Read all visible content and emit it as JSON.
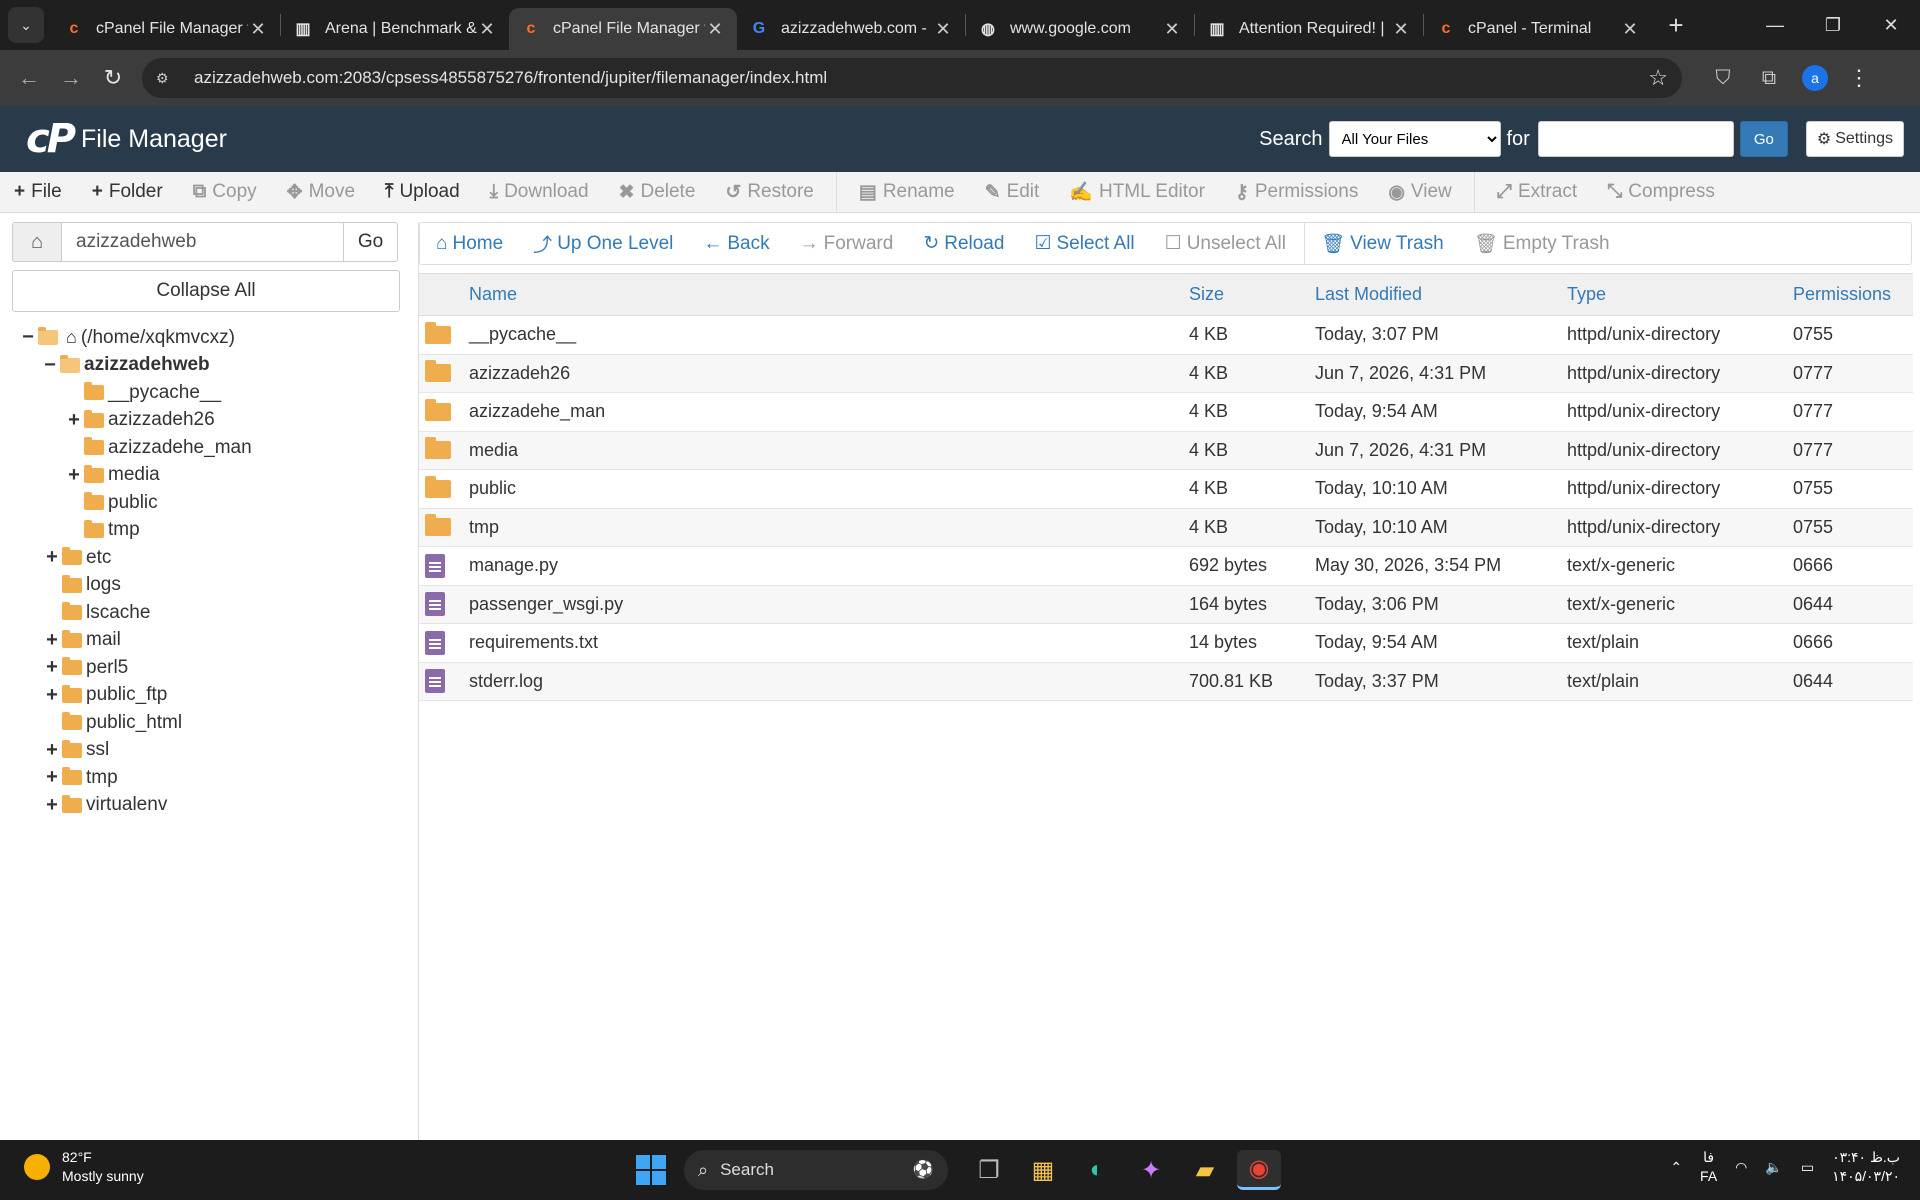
{
  "browser": {
    "tabs": [
      {
        "title": "cPanel File Manager v",
        "icon": "cpanel-icon",
        "active": false
      },
      {
        "title": "Arena | Benchmark &",
        "icon": "arena-icon",
        "active": false
      },
      {
        "title": "cPanel File Manager v",
        "icon": "cpanel-icon",
        "active": true
      },
      {
        "title": "azizzadehweb.com -",
        "icon": "google-icon",
        "active": false
      },
      {
        "title": "www.google.com",
        "icon": "globe-icon",
        "active": false
      },
      {
        "title": "Attention Required! |",
        "icon": "arena-icon",
        "active": false
      },
      {
        "title": "cPanel - Terminal",
        "icon": "cpanel-icon",
        "active": false
      }
    ],
    "url": "azizzadehweb.com:2083/cpsess4855875276/frontend/jupiter/filemanager/index.html",
    "profile_initial": "a"
  },
  "header": {
    "logo_mark": "cP",
    "title": "File Manager",
    "search_label": "Search",
    "search_scope": "All Your Files",
    "for_label": "for",
    "search_value": "",
    "go_label": "Go",
    "settings_label": "Settings"
  },
  "toolbar": {
    "file": "File",
    "folder": "Folder",
    "copy": "Copy",
    "move": "Move",
    "upload": "Upload",
    "download": "Download",
    "delete": "Delete",
    "restore": "Restore",
    "rename": "Rename",
    "edit": "Edit",
    "html_editor": "HTML Editor",
    "permissions": "Permissions",
    "view": "View",
    "extract": "Extract",
    "compress": "Compress"
  },
  "sidebar": {
    "path_value": "azizzadehweb",
    "go_label": "Go",
    "collapse_label": "Collapse All",
    "tree": {
      "root": "(/home/xqkmvcxz)",
      "current": "azizzadehweb",
      "c_pycache": "__pycache__",
      "c_azizzadeh26": "azizzadeh26",
      "c_azizzadehe_man": "azizzadehe_man",
      "c_media": "media",
      "c_public": "public",
      "c_tmp": "tmp",
      "etc": "etc",
      "logs": "logs",
      "lscache": "lscache",
      "mail": "mail",
      "perl5": "perl5",
      "public_ftp": "public_ftp",
      "public_html": "public_html",
      "ssl": "ssl",
      "tmp": "tmp",
      "virtualenv": "virtualenv"
    }
  },
  "navbar": {
    "home": "Home",
    "up_one_level": "Up One Level",
    "back": "Back",
    "forward": "Forward",
    "reload": "Reload",
    "select_all": "Select All",
    "unselect_all": "Unselect All",
    "view_trash": "View Trash",
    "empty_trash": "Empty Trash"
  },
  "table": {
    "headers": {
      "name": "Name",
      "size": "Size",
      "modified": "Last Modified",
      "type": "Type",
      "perms": "Permissions"
    },
    "rows": [
      {
        "kind": "dir",
        "name": "__pycache__",
        "size": "4 KB",
        "modified": "Today, 3:07 PM",
        "type": "httpd/unix-directory",
        "perms": "0755"
      },
      {
        "kind": "dir",
        "name": "azizzadeh26",
        "size": "4 KB",
        "modified": "Jun 7, 2026, 4:31 PM",
        "type": "httpd/unix-directory",
        "perms": "0777"
      },
      {
        "kind": "dir",
        "name": "azizzadehe_man",
        "size": "4 KB",
        "modified": "Today, 9:54 AM",
        "type": "httpd/unix-directory",
        "perms": "0777"
      },
      {
        "kind": "dir",
        "name": "media",
        "size": "4 KB",
        "modified": "Jun 7, 2026, 4:31 PM",
        "type": "httpd/unix-directory",
        "perms": "0777"
      },
      {
        "kind": "dir",
        "name": "public",
        "size": "4 KB",
        "modified": "Today, 10:10 AM",
        "type": "httpd/unix-directory",
        "perms": "0755"
      },
      {
        "kind": "dir",
        "name": "tmp",
        "size": "4 KB",
        "modified": "Today, 10:10 AM",
        "type": "httpd/unix-directory",
        "perms": "0755"
      },
      {
        "kind": "file",
        "name": "manage.py",
        "size": "692 bytes",
        "modified": "May 30, 2026, 3:54 PM",
        "type": "text/x-generic",
        "perms": "0666"
      },
      {
        "kind": "file",
        "name": "passenger_wsgi.py",
        "size": "164 bytes",
        "modified": "Today, 3:06 PM",
        "type": "text/x-generic",
        "perms": "0644"
      },
      {
        "kind": "file",
        "name": "requirements.txt",
        "size": "14 bytes",
        "modified": "Today, 9:54 AM",
        "type": "text/plain",
        "perms": "0666"
      },
      {
        "kind": "file",
        "name": "stderr.log",
        "size": "700.81 KB",
        "modified": "Today, 3:37 PM",
        "type": "text/plain",
        "perms": "0644"
      }
    ]
  },
  "taskbar": {
    "temp": "82°F",
    "condition": "Mostly sunny",
    "search_label": "Search",
    "lang_top": "فا",
    "lang_bottom": "FA",
    "time": "۰۳:۴۰ ب.ظ",
    "date": "۱۴۰۵/۰۳/۲۰"
  },
  "colors": {
    "header_bg": "#293a4a",
    "link": "#337ab7",
    "folder": "#f0ad4e",
    "file": "#8a6aa8"
  }
}
